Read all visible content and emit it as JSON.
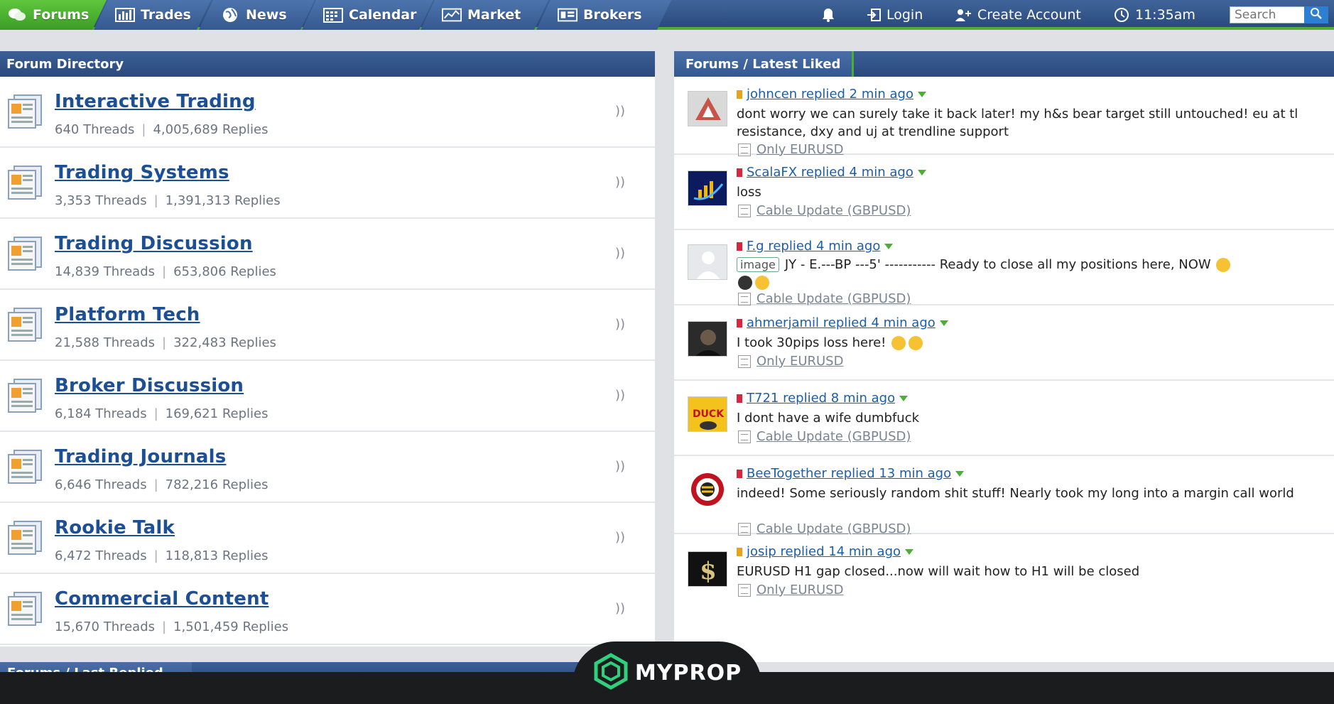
{
  "nav": {
    "tabs": [
      {
        "label": "Forums",
        "icon": "chat-bubbles-icon"
      },
      {
        "label": "Trades",
        "icon": "bar-chart-icon"
      },
      {
        "label": "News",
        "icon": "globe-icon"
      },
      {
        "label": "Calendar",
        "icon": "calendar-icon"
      },
      {
        "label": "Market",
        "icon": "market-chart-icon"
      },
      {
        "label": "Brokers",
        "icon": "brokers-icon"
      }
    ],
    "login": "Login",
    "create_account": "Create Account",
    "time": "11:35am",
    "search_placeholder": "Search"
  },
  "forum_directory": {
    "title": "Forum Directory",
    "forums": [
      {
        "name": "Interactive Trading",
        "threads": "640 Threads",
        "replies": "4,005,689 Replies"
      },
      {
        "name": "Trading Systems",
        "threads": "3,353 Threads",
        "replies": "1,391,313 Replies"
      },
      {
        "name": "Trading Discussion",
        "threads": "14,839 Threads",
        "replies": "653,806 Replies"
      },
      {
        "name": "Platform Tech",
        "threads": "21,588 Threads",
        "replies": "322,483 Replies"
      },
      {
        "name": "Broker Discussion",
        "threads": "6,184 Threads",
        "replies": "169,621 Replies"
      },
      {
        "name": "Trading Journals",
        "threads": "6,646 Threads",
        "replies": "782,216 Replies"
      },
      {
        "name": "Rookie Talk",
        "threads": "6,472 Threads",
        "replies": "118,813 Replies"
      },
      {
        "name": "Commercial Content",
        "threads": "15,670 Threads",
        "replies": "1,501,459 Replies"
      }
    ]
  },
  "latest_liked": {
    "title": "Forums / Latest Liked",
    "posts": [
      {
        "head": "johncen replied 2 min ago",
        "text": "dont worry we can surely take it back later! my h&s bear target still untouched! eu at tl resistance, dxy and uj at trendline support",
        "thread": "Only EURUSD",
        "flag": "#e8a317"
      },
      {
        "head": "ScalaFX replied 4 min ago",
        "text": "loss",
        "thread": "Cable Update (GBPUSD)",
        "flag": "#d7263d"
      },
      {
        "head": "F.g replied 4 min ago",
        "image_tag": "image",
        "text": "JY - E.---BP ---5' ----------- Ready to close all my positions here, NOW",
        "thread": "Cable Update (GBPUSD)",
        "flag": "#d7263d"
      },
      {
        "head": "ahmerjamil replied 4 min ago",
        "text": "I took 30pips loss here!",
        "thread": "Only EURUSD",
        "flag": "#d7263d"
      },
      {
        "head": "T721 replied 8 min ago",
        "text": "I dont have a wife dumbfuck",
        "thread": "Cable Update (GBPUSD)",
        "flag": "#d7263d"
      },
      {
        "head": "BeeTogether replied 13 min ago",
        "text": "indeed! Some seriously random shit stuff! Nearly took my long into a margin call world",
        "thread": "Cable Update (GBPUSD)",
        "flag": "#d7263d"
      },
      {
        "head": "josip replied 14 min ago",
        "text": "EURUSD H1 gap closed...now will wait how to H1 will be closed",
        "thread": "Only EURUSD",
        "flag": "#e8a317"
      }
    ]
  },
  "bottom": {
    "tab_label": "Forums / Last Replied"
  },
  "brand": {
    "logo_text": "MYPROP"
  },
  "colors": {
    "nav_active": "#4caf34",
    "nav_bg": "#34568b",
    "link": "#1d4f95"
  }
}
